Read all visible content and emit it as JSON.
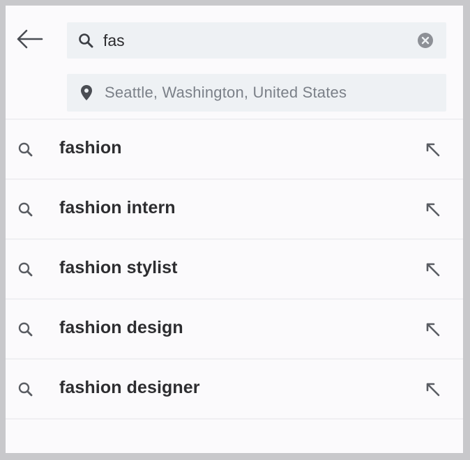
{
  "search": {
    "query": "fas",
    "location": "Seattle, Washington, United States"
  },
  "suggestions": [
    {
      "label": "fashion"
    },
    {
      "label": "fashion intern"
    },
    {
      "label": "fashion stylist"
    },
    {
      "label": "fashion design"
    },
    {
      "label": "fashion designer"
    }
  ],
  "icons": {
    "back": "arrow-left-icon",
    "search": "search-icon",
    "clear": "clear-circle-icon",
    "location": "location-pin-icon",
    "fill_query": "arrow-up-left-icon"
  },
  "colors": {
    "background": "#fbfafc",
    "field_background": "#eef1f4",
    "text_primary": "#2d2d30",
    "text_secondary": "#7b8088",
    "icon": "#5a5d63"
  }
}
